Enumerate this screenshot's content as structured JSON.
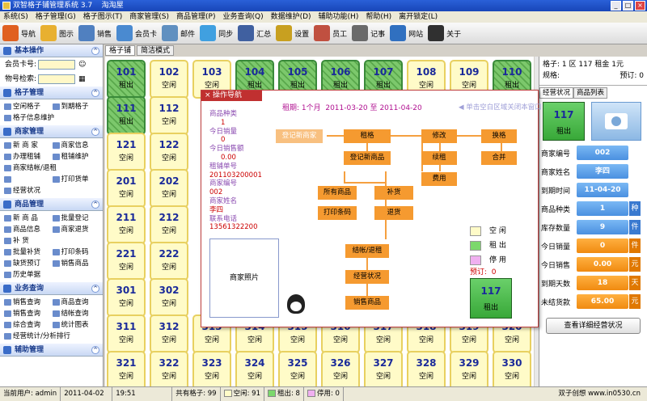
{
  "window": {
    "title": "双智格子铺管理系统 3.7",
    "shop": "淘淘屋"
  },
  "menu": [
    "系统(S)",
    "格子管理(G)",
    "格子图示(T)",
    "商家管理(S)",
    "商品管理(P)",
    "业务查询(Q)",
    "数据维护(D)",
    "辅助功能(H)",
    "帮助(H)",
    "离开锁定(L)"
  ],
  "toolbar": [
    {
      "label": "导航",
      "icon": "home-icon",
      "color": "#e06020"
    },
    {
      "label": "图示",
      "icon": "grid-icon",
      "color": "#e8b030"
    },
    {
      "label": "销售",
      "icon": "register-icon",
      "color": "#5080c0"
    },
    {
      "label": "会员卡",
      "icon": "members-icon",
      "color": "#4a8ad0"
    },
    {
      "label": "邮件",
      "icon": "mail-icon",
      "color": "#6090c0"
    },
    {
      "label": "同步",
      "icon": "sync-icon",
      "color": "#40a0e0"
    },
    {
      "label": "汇总",
      "icon": "summary-icon",
      "color": "#4060a0"
    },
    {
      "label": "设置",
      "icon": "settings-icon",
      "color": "#c8a020"
    },
    {
      "label": "员工",
      "icon": "staff-icon",
      "color": "#c05040"
    },
    {
      "label": "记事",
      "icon": "notes-icon",
      "color": "#6a6a6a"
    },
    {
      "label": "网站",
      "icon": "website-icon",
      "color": "#3070c0"
    },
    {
      "label": "关于",
      "icon": "about-icon",
      "color": "#303030"
    }
  ],
  "sidebar": {
    "basic": {
      "title": "基本操作",
      "member_label": "会员卡号:",
      "goods_label": "物号检索:"
    },
    "groups": [
      {
        "title": "格子管理",
        "cols": 2,
        "items": [
          "空闲格子",
          "到期格子",
          "格子信息维护"
        ]
      },
      {
        "title": "商家管理",
        "cols": 2,
        "items": [
          "新 商 家",
          "商家信息",
          "办理租铺",
          "租铺维护",
          "商家结帐/退租",
          "",
          "打印货单",
          "经营状况"
        ]
      },
      {
        "title": "商品管理",
        "cols": 2,
        "items": [
          "新 商 品",
          "批量登记",
          "商品信息",
          "商家退货",
          "补    货",
          "批量补货",
          "打印条码",
          "缺货预订",
          "销售商品",
          "历史单据"
        ]
      },
      {
        "title": "业务查询",
        "cols": 2,
        "items": [
          "销售查询",
          "商品查询",
          "销售查询",
          "结帐查询",
          "综合查询",
          "统计图表",
          "经营统计/分析排行"
        ]
      },
      {
        "title": "辅助管理",
        "cols": 2,
        "items": []
      }
    ]
  },
  "tabs": [
    "格子铺",
    "简洁模式"
  ],
  "grid_rows": [
    [
      [
        "101",
        "租出",
        "rent"
      ],
      [
        "102",
        "空闲",
        "free"
      ],
      [
        "103",
        "空闲",
        "free"
      ],
      [
        "104",
        "租出",
        "rent"
      ],
      [
        "105",
        "租出",
        "rent"
      ],
      [
        "106",
        "租出",
        "rent"
      ],
      [
        "107",
        "租出",
        "rent"
      ],
      [
        "108",
        "空闲",
        "free"
      ],
      [
        "109",
        "空闲",
        "free"
      ],
      [
        "110",
        "租出",
        "rent"
      ]
    ],
    [
      [
        "111",
        "租出",
        "rent"
      ],
      [
        "112",
        "空闲",
        "free"
      ]
    ],
    [
      [
        "121",
        "空闲",
        "free"
      ],
      [
        "122",
        "空闲",
        "free"
      ]
    ],
    [
      [
        "201",
        "空闲",
        "free"
      ],
      [
        "202",
        "空闲",
        "free"
      ]
    ],
    [
      [
        "211",
        "空闲",
        "free"
      ],
      [
        "212",
        "空闲",
        "free"
      ]
    ],
    [
      [
        "221",
        "空闲",
        "free"
      ],
      [
        "222",
        "空闲",
        "free"
      ]
    ],
    [
      [
        "301",
        "空闲",
        "free"
      ],
      [
        "302",
        "空闲",
        "free"
      ]
    ],
    [
      [
        "311",
        "空闲",
        "free"
      ],
      [
        "312",
        "空闲",
        "free"
      ],
      [
        "313",
        "空闲",
        "free"
      ],
      [
        "314",
        "空闲",
        "free"
      ],
      [
        "315",
        "空闲",
        "free"
      ],
      [
        "316",
        "空闲",
        "free"
      ],
      [
        "317",
        "空闲",
        "free"
      ],
      [
        "318",
        "空闲",
        "free"
      ],
      [
        "319",
        "空闲",
        "free"
      ],
      [
        "320",
        "空闲",
        "free"
      ]
    ],
    [
      [
        "321",
        "空闲",
        "free"
      ],
      [
        "322",
        "空闲",
        "free"
      ],
      [
        "323",
        "空闲",
        "free"
      ],
      [
        "324",
        "空闲",
        "free"
      ],
      [
        "325",
        "空闲",
        "free"
      ],
      [
        "326",
        "空闲",
        "free"
      ],
      [
        "327",
        "空闲",
        "free"
      ],
      [
        "328",
        "空闲",
        "free"
      ],
      [
        "329",
        "空闲",
        "free"
      ],
      [
        "330",
        "空闲",
        "free"
      ]
    ]
  ],
  "dialog": {
    "title": "操作导航",
    "period_label": "租期: 1个月",
    "date_from": "2011-03-20",
    "to": "至",
    "date_to": "2011-04-20",
    "hint": "单击空白区域关闭本窗口",
    "info": [
      {
        "label": "商品种类",
        "value": "1"
      },
      {
        "label": "今日销量",
        "value": "0"
      },
      {
        "label": "今日销售额",
        "value": "0.00"
      },
      {
        "label": "租铺单号",
        "value": "201103200001"
      },
      {
        "label": "商家编号",
        "value": "002"
      },
      {
        "label": "商家姓名",
        "value": "李四"
      },
      {
        "label": "联系电话",
        "value": "13561322200"
      }
    ],
    "photo_label": "商家照片",
    "flow": {
      "register_merchant": "登记新商家",
      "rent": "租格",
      "modify": "修改",
      "swap": "换格",
      "register_goods": "登记新商品",
      "renew": "续租",
      "merge": "合并",
      "fee": "费用",
      "all_goods": "所有商品",
      "restock": "补货",
      "print_barcode": "打印条码",
      "return_goods": "退货",
      "settle": "结帐/退租",
      "business_status": "经营状况",
      "sell_goods": "销售商品"
    },
    "legend": [
      {
        "label": "空  闲",
        "color": "#fffbc8"
      },
      {
        "label": "租  出",
        "color": "#7cd86c"
      },
      {
        "label": "停  用",
        "color": "#f0b0f0"
      }
    ],
    "preorder_label": "预订:",
    "preorder_value": "0",
    "cell": {
      "num": "117",
      "status": "租出"
    }
  },
  "right_panel": {
    "header_line1": "格子: 1 区 117 租金 1元",
    "spec_label": "规格:",
    "preorder": "预订: 0",
    "tabs": [
      "经营状况",
      "商品列表"
    ],
    "cell": {
      "num": "117",
      "status": "租出"
    },
    "fields": [
      {
        "label": "商家编号",
        "value": "002",
        "unit": ""
      },
      {
        "label": "商家姓名",
        "value": "李四",
        "unit": ""
      },
      {
        "label": "到期时间",
        "value": "11-04-20",
        "unit": ""
      },
      {
        "label": "商品种类",
        "value": "1",
        "unit": "种"
      },
      {
        "label": "库存数量",
        "value": "9",
        "unit": "件"
      },
      {
        "label": "今日销量",
        "value": "0",
        "unit": "件"
      },
      {
        "label": "今日销售",
        "value": "0.00",
        "unit": "元"
      },
      {
        "label": "到期天数",
        "value": "18",
        "unit": "天"
      },
      {
        "label": "未结货款",
        "value": "65.00",
        "unit": "元"
      }
    ],
    "detail_button": "查看详细经营状况"
  },
  "status": {
    "operator": "当前用户: admin",
    "date": "2011-04-02",
    "time": "19:51",
    "total": "共有格子: 99",
    "free": "空闲: 91",
    "rented": "租出: 8",
    "disabled": "停用: 0",
    "brand": "双子创想 www.in0530.cn"
  }
}
